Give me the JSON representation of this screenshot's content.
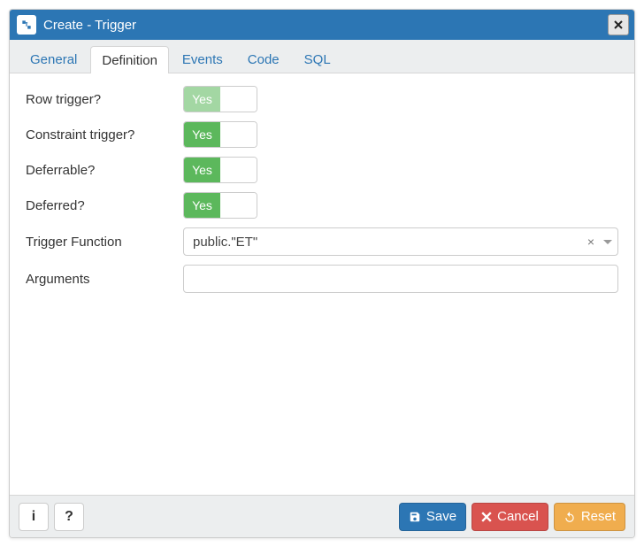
{
  "header": {
    "title": "Create - Trigger"
  },
  "tabs": [
    {
      "label": "General",
      "active": false
    },
    {
      "label": "Definition",
      "active": true
    },
    {
      "label": "Events",
      "active": false
    },
    {
      "label": "Code",
      "active": false
    },
    {
      "label": "SQL",
      "active": false
    }
  ],
  "form": {
    "row_trigger": {
      "label": "Row trigger?",
      "value": "Yes",
      "enabled": false
    },
    "constraint_trigger": {
      "label": "Constraint trigger?",
      "value": "Yes",
      "enabled": true
    },
    "deferrable": {
      "label": "Deferrable?",
      "value": "Yes",
      "enabled": true
    },
    "deferred": {
      "label": "Deferred?",
      "value": "Yes",
      "enabled": true
    },
    "trigger_function": {
      "label": "Trigger Function",
      "value": "public.\"ET\""
    },
    "arguments": {
      "label": "Arguments",
      "value": ""
    }
  },
  "footer": {
    "save": "Save",
    "cancel": "Cancel",
    "reset": "Reset"
  }
}
